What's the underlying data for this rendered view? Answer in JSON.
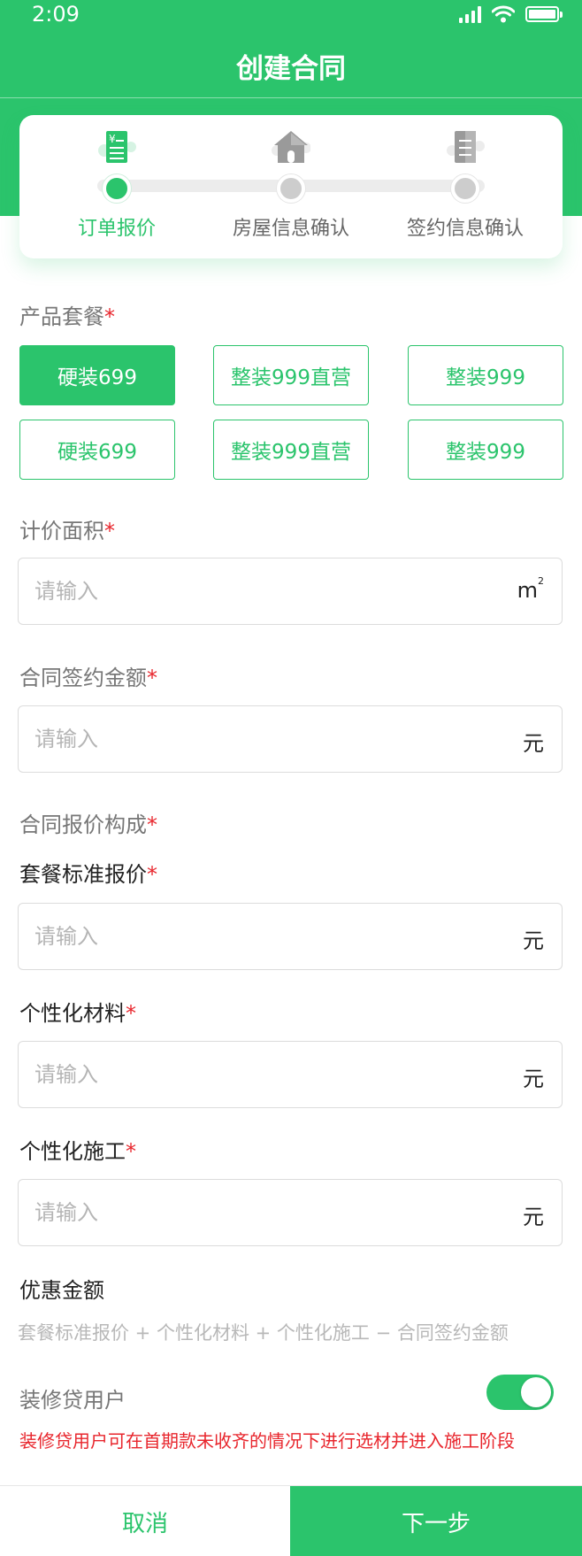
{
  "status_bar": {
    "time": "2:09",
    "icons": [
      "signal-icon",
      "wifi-icon",
      "battery-icon"
    ]
  },
  "nav": {
    "title": "创建合同"
  },
  "steps": [
    {
      "label": "订单报价",
      "icon": "receipt-yen-icon",
      "state": "active"
    },
    {
      "label": "房屋信息确认",
      "icon": "house-icon",
      "state": "inactive"
    },
    {
      "label": "签约信息确认",
      "icon": "document-icon",
      "state": "inactive"
    }
  ],
  "product_package": {
    "label": "产品套餐",
    "required_mark": "*",
    "options": [
      {
        "label": "硬装699",
        "selected": true
      },
      {
        "label": "整装999直营",
        "selected": false
      },
      {
        "label": "整装999",
        "selected": false
      },
      {
        "label": "硬装699",
        "selected": false
      },
      {
        "label": "整装999直营",
        "selected": false
      },
      {
        "label": "整装999",
        "selected": false
      }
    ]
  },
  "pricing_area": {
    "label": "计价面积",
    "required_mark": "*",
    "placeholder": "请输入",
    "value": "",
    "unit": "m",
    "unit_sup": "2"
  },
  "contract_amount": {
    "label": "合同签约金额",
    "required_mark": "*",
    "placeholder": "请输入",
    "value": "",
    "unit": "元"
  },
  "quote_composition": {
    "label": "合同报价构成",
    "required_mark": "*"
  },
  "standard_quote": {
    "label": "套餐标准报价",
    "required_mark": "*",
    "placeholder": "请输入",
    "value": "",
    "unit": "元"
  },
  "custom_material": {
    "label": "个性化材料",
    "required_mark": "*",
    "placeholder": "请输入",
    "value": "",
    "unit": "元"
  },
  "custom_construction": {
    "label": "个性化施工",
    "required_mark": "*",
    "placeholder": "请输入",
    "value": "",
    "unit": "元"
  },
  "discount": {
    "label": "优惠金额",
    "formula": "套餐标准报价 + 个性化材料 + 个性化施工 − 合同签约金额"
  },
  "loan_user": {
    "label": "装修贷用户",
    "enabled": true,
    "note": "装修贷用户可在首期款未收齐的情况下进行选材并进入施工阶段"
  },
  "footer": {
    "cancel_label": "取消",
    "next_label": "下一步"
  },
  "colors": {
    "primary": "#2bc46c",
    "required": "#e8262d",
    "placeholder": "#b5b5b5",
    "track": "#ececec"
  }
}
